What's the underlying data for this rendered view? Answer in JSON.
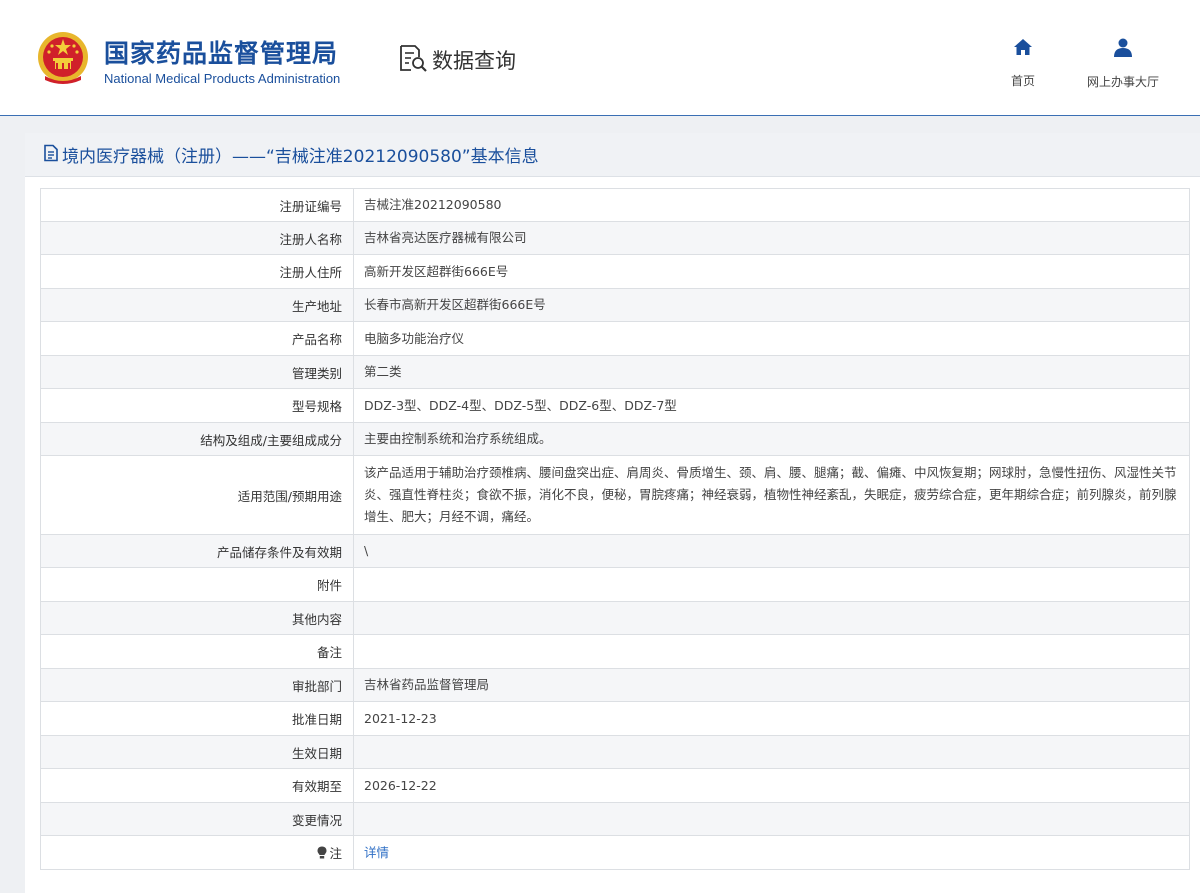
{
  "header": {
    "logo_cn": "国家药品监督管理局",
    "logo_en": "National Medical Products Administration",
    "emblem_icon": "national-emblem-icon",
    "data_query_label": "数据查询",
    "data_query_icon": "document-search-icon",
    "nav": [
      {
        "label": "首页",
        "icon": "home-icon"
      },
      {
        "label": "网上办事大厅",
        "icon": "user-icon"
      }
    ]
  },
  "panel": {
    "title": "境内医疗器械（注册）——“吉械注准20212090580”基本信息",
    "title_icon": "document-icon"
  },
  "rows": [
    {
      "label": "注册证编号",
      "value": "吉械注准20212090580",
      "height": 33
    },
    {
      "label": "注册人名称",
      "value": "吉林省亮达医疗器械有限公司",
      "height": 33
    },
    {
      "label": "注册人住所",
      "value": "高新开发区超群街666E号",
      "height": 34
    },
    {
      "label": "生产地址",
      "value": "长春市高新开发区超群街666E号",
      "height": 33
    },
    {
      "label": "产品名称",
      "value": "电脑多功能治疗仪",
      "height": 34
    },
    {
      "label": "管理类别",
      "value": "第二类",
      "height": 33
    },
    {
      "label": "型号规格",
      "value": "DDZ-3型、DDZ-4型、DDZ-5型、DDZ-6型、DDZ-7型",
      "height": 34
    },
    {
      "label": "结构及组成/主要组成成分",
      "value": "主要由控制系统和治疗系统组成。",
      "height": 33
    },
    {
      "label": "适用范围/预期用途",
      "value": "该产品适用于辅助治疗颈椎病、腰间盘突出症、肩周炎、骨质增生、颈、肩、腰、腿痛；截、偏瘫、中风恢复期；网球肘，急慢性扭伤、风湿性关节炎、强直性脊柱炎；食欲不振，消化不良，便秘，胃脘疼痛；神经衰弱，植物性神经紊乱，失眠症，疲劳综合症，更年期综合症；前列腺炎，前列腺增生、肥大；月经不调，痛经。",
      "height": 79
    },
    {
      "label": "产品储存条件及有效期",
      "value": "\\",
      "height": 33
    },
    {
      "label": "附件",
      "value": "",
      "height": 34
    },
    {
      "label": "其他内容",
      "value": "",
      "height": 33
    },
    {
      "label": "备注",
      "value": "",
      "height": 34
    },
    {
      "label": "审批部门",
      "value": "吉林省药品监督管理局",
      "height": 33
    },
    {
      "label": "批准日期",
      "value": "2021-12-23",
      "height": 34
    },
    {
      "label": "生效日期",
      "value": "",
      "height": 33
    },
    {
      "label": "有效期至",
      "value": "2026-12-22",
      "height": 34
    },
    {
      "label": "变更情况",
      "value": "",
      "height": 33
    }
  ],
  "note_row": {
    "label": "注",
    "label_icon": "lightbulb-icon",
    "link": "详情"
  },
  "colors": {
    "brand_blue": "#1a4f9c",
    "link_blue": "#2f6fc5",
    "emblem_red": "#d0202a",
    "emblem_gold": "#e8b62c"
  }
}
